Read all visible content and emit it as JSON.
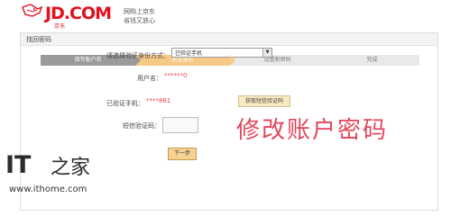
{
  "header": {
    "logo_text": "JD.COM",
    "logo_sub": "京东",
    "slogan_line1": "网购上京东",
    "slogan_line2": "省钱又放心"
  },
  "panel": {
    "title": "找回密码"
  },
  "steps": [
    {
      "label": "填写账户名",
      "state": "done"
    },
    {
      "label": "验证身份",
      "state": "active"
    },
    {
      "label": "设置新密码",
      "state": "todo"
    },
    {
      "label": "完成",
      "state": "todo"
    }
  ],
  "form": {
    "method_label": "请选择验证身份方式：",
    "method_value": "已验证手机",
    "username_label": "用户名：",
    "username_masked": "******0",
    "phone_label": "已验证手机：",
    "phone_masked": "****",
    "phone_suffix": "861",
    "get_code_button": "获取短信验证码",
    "sms_label": "短信验证码：",
    "next_button": "下一步"
  },
  "overlay": {
    "text": "修改账户密码"
  },
  "watermark": {
    "brand_it": "IT",
    "brand_home": "之家",
    "url": "www.ithome.com"
  },
  "colors": {
    "brand_red": "#e3101e",
    "step_done": "#9a9a9a",
    "step_active": "#f6c986",
    "overlay": "#e2465a"
  }
}
